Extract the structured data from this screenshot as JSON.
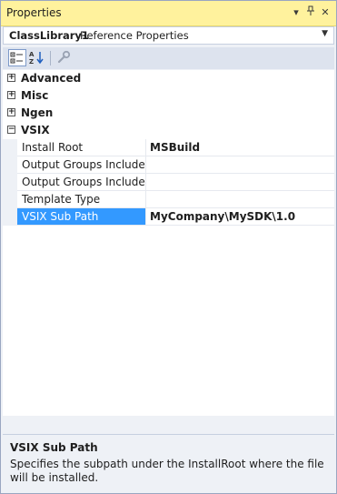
{
  "window": {
    "title": "Properties"
  },
  "titlebar_buttons": {
    "dropdown": "▾",
    "pin": "📌",
    "close": "✕"
  },
  "object_selector": {
    "name": "ClassLibrary1",
    "type": "Reference Properties"
  },
  "toolbar": {
    "items": [
      "categorized-icon",
      "alphabetical-icon",
      "property-pages-icon"
    ]
  },
  "categories": [
    {
      "label": "Advanced",
      "expanded": false,
      "glyph": "+"
    },
    {
      "label": "Misc",
      "expanded": false,
      "glyph": "+"
    },
    {
      "label": "Ngen",
      "expanded": false,
      "glyph": "+"
    },
    {
      "label": "VSIX",
      "expanded": true,
      "glyph": "−"
    }
  ],
  "properties": [
    {
      "name": "Install Root",
      "value": "MSBuild"
    },
    {
      "name": "Output Groups Included in",
      "value": ""
    },
    {
      "name": "Output Groups Included in",
      "value": ""
    },
    {
      "name": "Template Type",
      "value": ""
    },
    {
      "name": "VSIX Sub Path",
      "value": "MyCompany\\MySDK\\1.0",
      "selected": true
    }
  ],
  "description": {
    "title": "VSIX Sub Path",
    "text": "Specifies the subpath under the InstallRoot where the file will be installed."
  },
  "colors": {
    "titlebar": "#fff29d",
    "selection": "#3399ff",
    "panel": "#eef1f6"
  }
}
